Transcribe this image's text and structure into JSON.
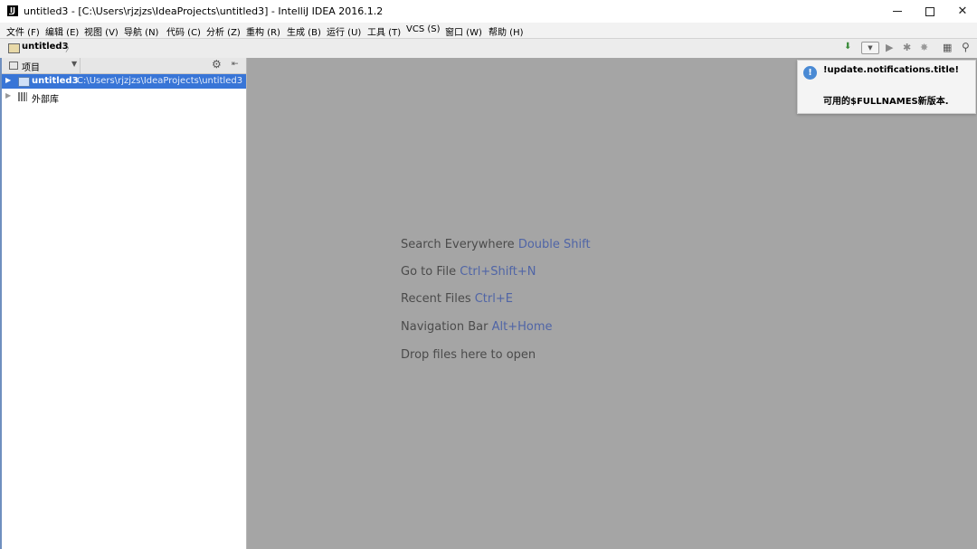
{
  "window": {
    "title": "untitled3 - [C:\\Users\\rjzjzs\\IdeaProjects\\untitled3] - IntelliJ IDEA 2016.1.2",
    "logo_text": "IJ",
    "close_glyph": "✕"
  },
  "menu": [
    {
      "label": "文件 (F)"
    },
    {
      "label": "编辑 (E)"
    },
    {
      "label": "视图 (V)"
    },
    {
      "label": "导航 (N)"
    },
    {
      "label": "代码 (C)"
    },
    {
      "label": "分析 (Z)"
    },
    {
      "label": "重构 (R)"
    },
    {
      "label": "生成 (B)"
    },
    {
      "label": "运行 (U)"
    },
    {
      "label": "工具 (T)"
    },
    {
      "label": "VCS (S)"
    },
    {
      "label": "窗口 (W)"
    },
    {
      "label": "帮助 (H)"
    }
  ],
  "navbar": {
    "project_name": "untitled3",
    "chevron": "〉",
    "toolbar_icons": [
      "build-icon",
      "run-config-dropdown",
      "run-icon",
      "debug-icon",
      "coverage-icon",
      "project-structure-icon",
      "search-icon"
    ],
    "glyphs": {
      "build": "⬇",
      "dropdown": "▼",
      "run": "▶",
      "debug": "✱",
      "coverage": "✸",
      "structure": "▦",
      "search": "⚲"
    }
  },
  "project_panel": {
    "header_label": "项目",
    "header_dropdown": "▼",
    "gear_glyph": "⚙",
    "hide_glyph": "⇤",
    "tree": [
      {
        "name": "untitled3",
        "path": "C:\\Users\\rjzjzs\\IdeaProjects\\untitled3",
        "selected": true,
        "arrow": "▶"
      },
      {
        "name": "外部库",
        "arrow": "▶"
      }
    ]
  },
  "editor": {
    "hints": [
      {
        "text": "Search Everywhere",
        "shortcut": "Double Shift"
      },
      {
        "text": "Go to File",
        "shortcut": "Ctrl+Shift+N"
      },
      {
        "text": "Recent Files",
        "shortcut": "Ctrl+E"
      },
      {
        "text": "Navigation Bar",
        "shortcut": "Alt+Home"
      },
      {
        "text": "Drop files here to open",
        "shortcut": ""
      }
    ]
  },
  "notification": {
    "icon_glyph": "!",
    "title": "!update.notifications.title!",
    "body": "可用的$FULLNAMES新版本."
  },
  "colors": {
    "selection": "#3875d7",
    "editor_bg": "#a5a5a5",
    "shortcut": "#5065a6",
    "info_icon": "#4a8ad4"
  }
}
